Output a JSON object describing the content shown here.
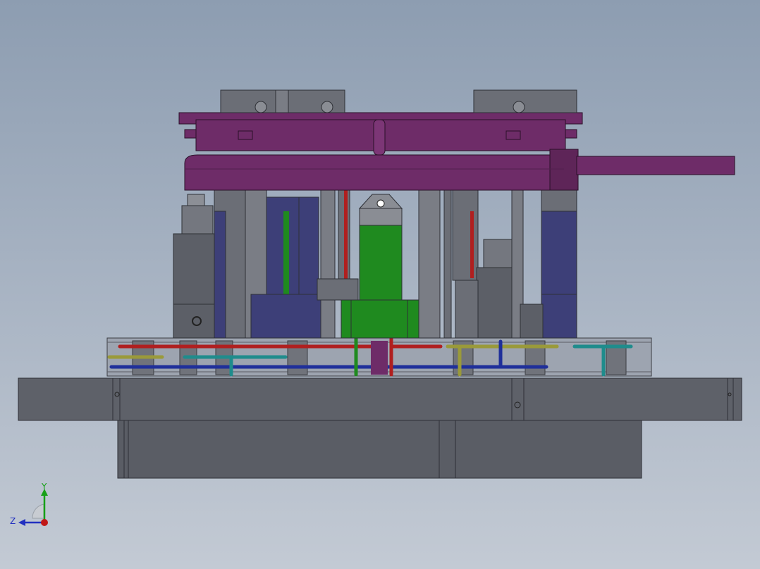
{
  "viewport": {
    "background_top": "#8d9db1",
    "background_bottom": "#c3cad4"
  },
  "model": {
    "colors": {
      "frame_gray": "#6b6e76",
      "frame_dark": "#4f525a",
      "clamp_purple": "#6e2c68",
      "clamp_purple_dark": "#52204e",
      "cylinder_blue": "#3d3f78",
      "valve_green": "#1f8a1f",
      "pipe_red": "#b01f1f",
      "pipe_blue": "#1f2f9a",
      "pipe_cyan": "#1f8c8c",
      "pipe_olive": "#9a9a3a"
    }
  },
  "triad": {
    "y_label": "Y",
    "z_label": "Z",
    "y_color": "#17a017",
    "z_color": "#2230c0",
    "x_color": "#c01717",
    "icon": "coordinate-triad-icon"
  }
}
